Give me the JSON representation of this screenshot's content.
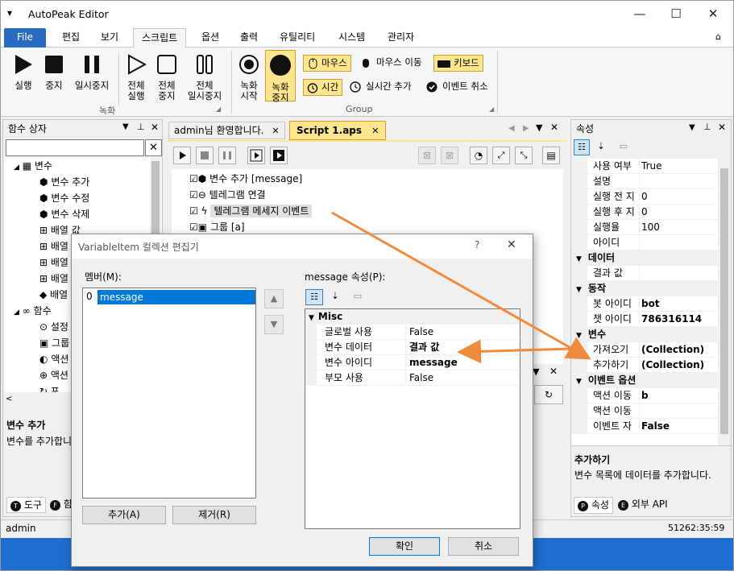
{
  "app": {
    "title": "AutoPeak Editor"
  },
  "ribbon_tabs": [
    {
      "label": "File"
    },
    {
      "label": "편집"
    },
    {
      "label": "보기"
    },
    {
      "label": "스크립트"
    },
    {
      "label": "옵션"
    },
    {
      "label": "출력"
    },
    {
      "label": "유틸리티"
    },
    {
      "label": "시스템"
    },
    {
      "label": "관리자"
    }
  ],
  "ribbon": {
    "record_group": "녹화",
    "group_group": "Group",
    "run": "실행",
    "stop": "중지",
    "pause": "일시중지",
    "run_all_1": "전체",
    "run_all_2": "실행",
    "stop_all_1": "전체",
    "stop_all_2": "중지",
    "pause_all_1": "전체",
    "pause_all_2": "일시중지",
    "rec_start_1": "녹화",
    "rec_start_2": "시작",
    "rec_stop_1": "녹화",
    "rec_stop_2": "중지",
    "mouse": "마우스",
    "mouse_move": "마우스 이동",
    "keyboard": "키보드",
    "time": "시간",
    "realtime_add": "실시간 추가",
    "event_cancel": "이벤트 취소"
  },
  "left_panel": {
    "title": "함수 상자",
    "tree": [
      {
        "label": "변수"
      },
      {
        "label": "변수 추가"
      },
      {
        "label": "변수 수정"
      },
      {
        "label": "변수 삭제"
      },
      {
        "label": "배열 값"
      },
      {
        "label": "배열"
      },
      {
        "label": "배열"
      },
      {
        "label": "배열"
      },
      {
        "label": "배열"
      },
      {
        "label": "함수"
      },
      {
        "label": "설정"
      },
      {
        "label": "그룹"
      },
      {
        "label": "액션"
      },
      {
        "label": "액션"
      },
      {
        "label": "포"
      }
    ],
    "desc_title": "변수 추가",
    "desc_text": "변수를 추가합니",
    "bottom_tabs": [
      {
        "label": "도구"
      },
      {
        "label": "함"
      }
    ]
  },
  "doc_tabs": [
    {
      "label": "admin님 환영합니다."
    },
    {
      "label": "Script 1.aps"
    }
  ],
  "script_lines": [
    {
      "label": "변수 추가 [message]"
    },
    {
      "label": "텔레그램 연결"
    },
    {
      "label": "텔레그램 메세지 이벤트"
    },
    {
      "label": "그룹 [a]"
    }
  ],
  "props_panel": {
    "title": "속성",
    "rows": [
      {
        "name": "사용 여부",
        "value": "True"
      },
      {
        "name": "설명",
        "value": ""
      },
      {
        "name": "실행 전 지",
        "value": "0"
      },
      {
        "name": "실행 후 지",
        "value": "0"
      },
      {
        "name": "실행율",
        "value": "100"
      },
      {
        "name": "아이디",
        "value": ""
      }
    ],
    "cat_data": "데이터",
    "data_rows": [
      {
        "name": "결과 값",
        "value": ""
      }
    ],
    "cat_action": "동작",
    "action_rows": [
      {
        "name": "봇 아이디",
        "value": "bot"
      },
      {
        "name": "챗 아이디",
        "value": "786316114"
      }
    ],
    "cat_var": "변수",
    "var_rows": [
      {
        "name": "가져오기",
        "value": "(Collection)"
      },
      {
        "name": "추가하기",
        "value": "(Collection)"
      }
    ],
    "cat_event": "이벤트 옵션",
    "event_rows": [
      {
        "name": "액션 이동",
        "value": "b"
      },
      {
        "name": "액션 이동",
        "value": ""
      },
      {
        "name": "이벤트 자",
        "value": "False"
      }
    ],
    "desc_title": "추가하기",
    "desc_text": "변수 목록에 데이터를 추가합니다.",
    "bottom_tabs": [
      {
        "label": "속성"
      },
      {
        "label": "외부 API"
      }
    ]
  },
  "status": {
    "user": "admin",
    "time": "51262:35:59"
  },
  "dialog": {
    "title": "VariableItem 컬렉션 편집기",
    "help": "?",
    "members_label": "멤버(M):",
    "members": [
      {
        "index": "0",
        "name": "message"
      }
    ],
    "props_label": "message 속성(P):",
    "category": "Misc",
    "props": [
      {
        "name": "글로벌 사용",
        "value": "False"
      },
      {
        "name": "변수 데이터",
        "value": "결과 값"
      },
      {
        "name": "변수 아이디",
        "value": "message"
      },
      {
        "name": "부모 사용",
        "value": "False"
      }
    ],
    "add": "추가(A)",
    "remove": "제거(R)",
    "ok": "확인",
    "cancel": "취소"
  },
  "colors": {
    "accent": "#2a6bc2",
    "arrow": "#f08a3c",
    "chip": "#fde68f",
    "selection": "#0078d7"
  }
}
